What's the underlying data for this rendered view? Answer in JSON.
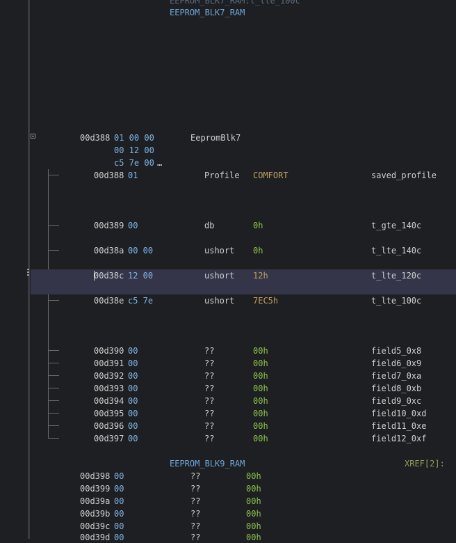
{
  "top": {
    "faded_label": "EEPROM_BLK7_RAM:t_lte_100c",
    "label": "EEPROM_BLK7_RAM"
  },
  "struct": {
    "address": "00d388",
    "bytes_line1": "01 00 00",
    "bytes_line2": "00 12 00",
    "bytes_line3": "c5 7e 00",
    "ellipsis": "…",
    "type_name": "EepromBlk7"
  },
  "fields": [
    {
      "addr": "00d388",
      "bytes": "01",
      "type": "Profile",
      "value": "COMFORT",
      "name": "saved_profile"
    },
    {
      "addr": "00d389",
      "bytes": "00",
      "type": "db",
      "value": "0h",
      "name": "t_gte_140c"
    },
    {
      "addr": "00d38a",
      "bytes": "00 00",
      "type": "ushort",
      "value": "0h",
      "name": "t_lte_140c"
    },
    {
      "addr": "00d38c",
      "bytes": "12 00",
      "type": "ushort",
      "value": "12h",
      "name": "t_lte_120c"
    },
    {
      "addr": "00d38e",
      "bytes": "c5 7e",
      "type": "ushort",
      "value": "7EC5h",
      "name": "t_lte_100c"
    },
    {
      "addr": "00d390",
      "bytes": "00",
      "type": "??",
      "value": "00h",
      "name": "field5_0x8"
    },
    {
      "addr": "00d391",
      "bytes": "00",
      "type": "??",
      "value": "00h",
      "name": "field6_0x9"
    },
    {
      "addr": "00d392",
      "bytes": "00",
      "type": "??",
      "value": "00h",
      "name": "field7_0xa"
    },
    {
      "addr": "00d393",
      "bytes": "00",
      "type": "??",
      "value": "00h",
      "name": "field8_0xb"
    },
    {
      "addr": "00d394",
      "bytes": "00",
      "type": "??",
      "value": "00h",
      "name": "field9_0xc"
    },
    {
      "addr": "00d395",
      "bytes": "00",
      "type": "??",
      "value": "00h",
      "name": "field10_0xd"
    },
    {
      "addr": "00d396",
      "bytes": "00",
      "type": "??",
      "value": "00h",
      "name": "field11_0xe"
    },
    {
      "addr": "00d397",
      "bytes": "00",
      "type": "??",
      "value": "00h",
      "name": "field12_0xf"
    }
  ],
  "blk9": {
    "label": "EEPROM_BLK9_RAM",
    "xref": "XREF[2]:",
    "rows": [
      {
        "addr": "00d398",
        "bytes": "00",
        "type": "??",
        "value": "00h"
      },
      {
        "addr": "00d399",
        "bytes": "00",
        "type": "??",
        "value": "00h"
      },
      {
        "addr": "00d39a",
        "bytes": "00",
        "type": "??",
        "value": "00h"
      },
      {
        "addr": "00d39b",
        "bytes": "00",
        "type": "??",
        "value": "00h"
      },
      {
        "addr": "00d39c",
        "bytes": "00",
        "type": "??",
        "value": "00h"
      },
      {
        "addr": "00d39d",
        "bytes": "00",
        "type": "??",
        "value": "00h"
      }
    ]
  },
  "colors": {
    "background": "#1e1f22",
    "selection": "#343549",
    "label": "#6fa8dc",
    "value": "#8bc34a"
  }
}
